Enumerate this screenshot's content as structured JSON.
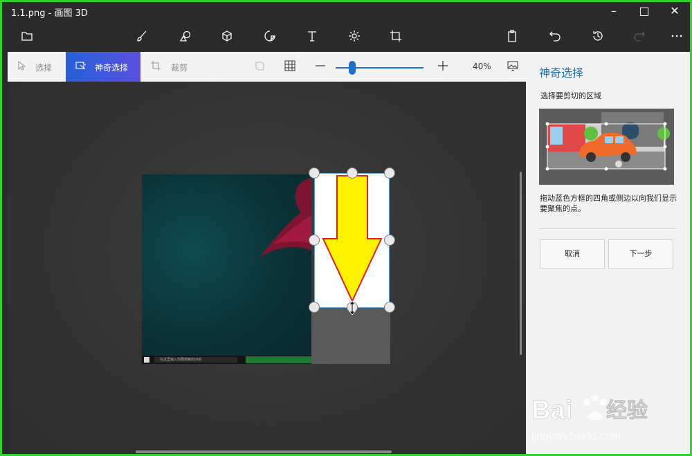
{
  "window": {
    "title": "1.1.png - 画图 3D"
  },
  "toolbar": {
    "icons": [
      "folder-icon",
      "brush-icon",
      "shapes-2d-icon",
      "cube-3d-icon",
      "stickers-icon",
      "text-icon",
      "effects-icon",
      "crop-canvas-icon",
      "paste-icon",
      "undo-icon",
      "history-icon",
      "redo-icon",
      "more-icon"
    ]
  },
  "subtoolbar": {
    "select_label": "选择",
    "magic_select_label": "神奇选择",
    "crop_label": "裁剪",
    "zoom_percent": "40%",
    "zoom_level": 0.2
  },
  "taskbar_search_text": "在这里输入你要搜索的内容",
  "panel": {
    "title": "神奇选择",
    "subtitle": "选择要剪切的区域",
    "description": "拖动蓝色方框的四角或侧边以向我们显示要聚焦的点。",
    "cancel_label": "取消",
    "next_label": "下一步"
  },
  "watermark": {
    "brand": "Bai经验",
    "url": "jingyan.baidu.com"
  },
  "colors": {
    "accent": "#1f6fd1",
    "panel_title": "#1f6fb0",
    "arrow_fill": "#fff200",
    "arrow_stroke": "#e02020",
    "border": "#2fd22f"
  }
}
